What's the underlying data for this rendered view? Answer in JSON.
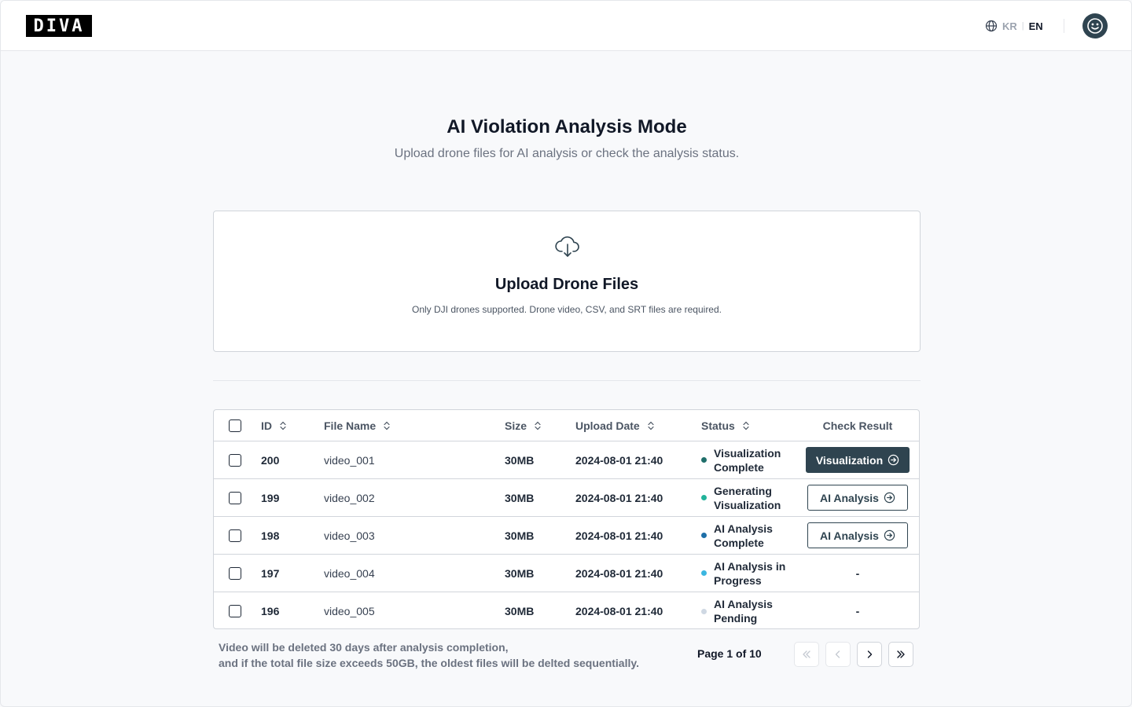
{
  "header": {
    "logo_text": "DIVA",
    "lang_kr": "KR",
    "lang_sep": "|",
    "lang_en": "EN"
  },
  "page": {
    "title": "AI Violation Analysis Mode",
    "subtitle": "Upload drone files for AI analysis or check the analysis status."
  },
  "upload": {
    "title": "Upload Drone Files",
    "description": "Only DJI drones supported. Drone video, CSV, and SRT files are required."
  },
  "table": {
    "columns": {
      "id": "ID",
      "file_name": "File Name",
      "size": "Size",
      "upload_date": "Upload Date",
      "status": "Status",
      "check_result": "Check Result"
    },
    "rows": [
      {
        "id": "200",
        "file_name": "video_001",
        "size": "30MB",
        "upload_date": "2024-08-01 21:40",
        "status": "Visualization Complete",
        "status_color": "#1f6e6a",
        "result": "Visualization"
      },
      {
        "id": "199",
        "file_name": "video_002",
        "size": "30MB",
        "upload_date": "2024-08-01 21:40",
        "status": "Generating Visualization",
        "status_color": "#22b39a",
        "result": "AI Analysis"
      },
      {
        "id": "198",
        "file_name": "video_003",
        "size": "30MB",
        "upload_date": "2024-08-01 21:40",
        "status": "AI Analysis Complete",
        "status_color": "#1e6fa8",
        "result": "AI Analysis"
      },
      {
        "id": "197",
        "file_name": "video_004",
        "size": "30MB",
        "upload_date": "2024-08-01 21:40",
        "status": "AI Analysis in Progress",
        "status_color": "#3bb6e0",
        "result": "-"
      },
      {
        "id": "196",
        "file_name": "video_005",
        "size": "30MB",
        "upload_date": "2024-08-01 21:40",
        "status": "AI Analysis Pending",
        "status_color": "#cfd8e3",
        "result": "-"
      }
    ]
  },
  "footer": {
    "notice_line1": "Video will be deleted 30 days after analysis completion,",
    "notice_line2": "and if the total file size exceeds 50GB, the oldest files will be delted sequentially.",
    "page_info": "Page 1 of 10"
  },
  "colors": {
    "accent": "#2f4450",
    "border": "#d1d5db",
    "background": "#f8f9fb"
  },
  "icons": {
    "language": "globe-icon",
    "profile": "smiley-icon",
    "upload": "cloud-download-icon",
    "sort": "sort-icon",
    "arrow": "arrow-circle-right-icon"
  }
}
